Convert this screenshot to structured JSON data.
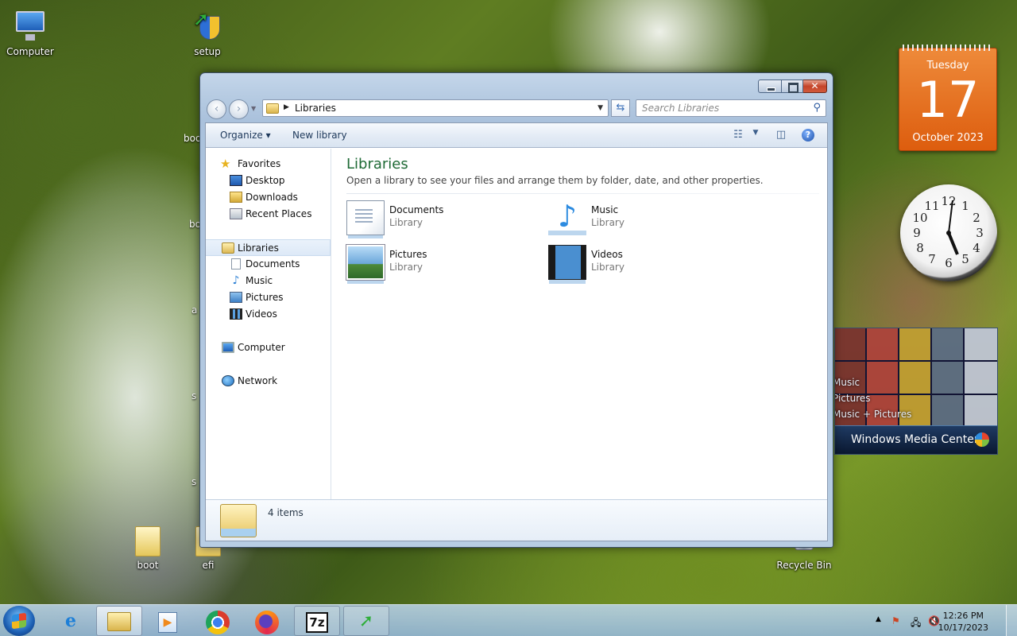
{
  "desktop": {
    "icons": [
      {
        "label": "Computer",
        "icon": "computer-icon"
      },
      {
        "label": "setup",
        "icon": "setup-icon"
      },
      {
        "label": "boot",
        "icon": "folder-icon"
      },
      {
        "label": "efi",
        "icon": "folder-icon"
      },
      {
        "label": "Recycle Bin",
        "icon": "recycle-bin-icon"
      }
    ],
    "hidden_fragments": [
      "boo",
      "bo",
      "a",
      "s",
      "s"
    ]
  },
  "explorer": {
    "caption": {
      "minimize": "minimize",
      "maximize": "maximize",
      "close": "✕"
    },
    "address": {
      "crumb": "Libraries"
    },
    "search": {
      "placeholder": "Search Libraries"
    },
    "toolbar": {
      "organize": "Organize",
      "new_library": "New library",
      "help": "?"
    },
    "nav": {
      "favorites": "Favorites",
      "desktop": "Desktop",
      "downloads": "Downloads",
      "recent": "Recent Places",
      "libraries": "Libraries",
      "documents": "Documents",
      "music": "Music",
      "pictures": "Pictures",
      "videos": "Videos",
      "computer": "Computer",
      "network": "Network"
    },
    "main": {
      "title": "Libraries",
      "subtitle": "Open a library to see your files and arrange them by folder, date, and other properties.",
      "items": [
        {
          "name": "Documents",
          "kind": "Library",
          "icon": "documents-library-icon"
        },
        {
          "name": "Music",
          "kind": "Library",
          "icon": "music-library-icon"
        },
        {
          "name": "Pictures",
          "kind": "Library",
          "icon": "pictures-library-icon"
        },
        {
          "name": "Videos",
          "kind": "Library",
          "icon": "videos-library-icon"
        }
      ]
    },
    "details": {
      "count": "4 items"
    }
  },
  "gadgets": {
    "calendar": {
      "weekday": "Tuesday",
      "day": "17",
      "month_year": "October 2023",
      "accent": "#dd5d0e"
    },
    "clock": {
      "dial": [
        "12",
        "1",
        "2",
        "3",
        "4",
        "5",
        "6",
        "7",
        "8",
        "9",
        "10",
        "11"
      ]
    },
    "media_center": {
      "menu": [
        "Music",
        "Pictures",
        "Music + Pictures"
      ],
      "title": "Windows Media Center"
    }
  },
  "taskbar": {
    "apps": [
      "internet-explorer-icon",
      "windows-explorer-icon",
      "media-player-icon",
      "chrome-icon",
      "firefox-icon",
      "7zip-icon",
      "setup-icon"
    ],
    "seven_zip": "7z",
    "time": "12:26 PM",
    "date": "10/17/2023"
  }
}
